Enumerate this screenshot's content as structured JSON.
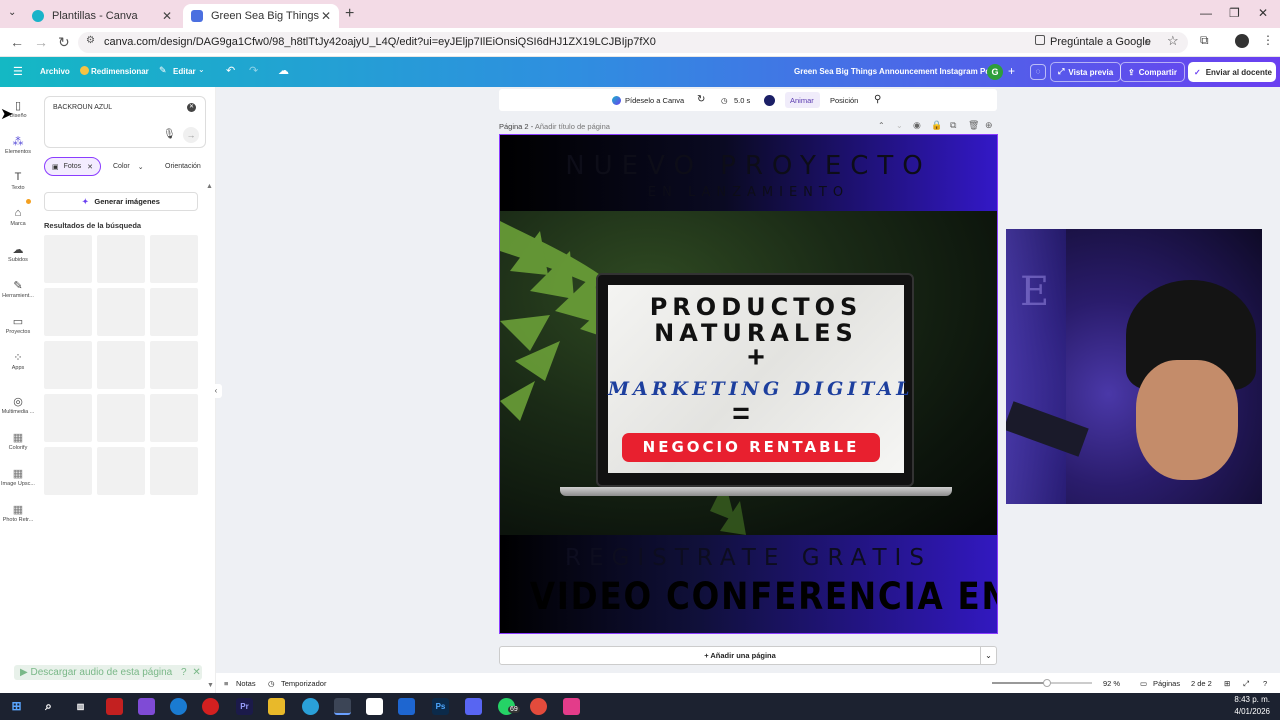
{
  "browser": {
    "tabs": [
      {
        "title": "Plantillas - Canva",
        "active": false
      },
      {
        "title": "Green Sea Big Things Announce",
        "active": true
      }
    ],
    "url": "canva.com/design/DAG9ga1Cfw0/98_h8tlTtJy42oajyU_L4Q/edit?ui=eyJEljp7IlEiOnsiQSI6dHJ1ZX19LCJBIjp7fX0",
    "ask_google": "Pregúntale a Google"
  },
  "canva_bar": {
    "file": "Archivo",
    "resize": "Redimensionar",
    "edit": "Editar",
    "doc_title": "Green Sea Big Things Announcement Instagram Post",
    "avatar": "G",
    "preview": "Vista previa",
    "share": "Compartir",
    "send_teacher": "Enviar al docente"
  },
  "rail": [
    {
      "label": "Diseño",
      "icon": "layout-icon"
    },
    {
      "label": "Elementos",
      "icon": "elements-icon"
    },
    {
      "label": "Texto",
      "icon": "text-icon"
    },
    {
      "label": "Marca",
      "icon": "brand-icon"
    },
    {
      "label": "Subidos",
      "icon": "upload-icon"
    },
    {
      "label": "Herramient...",
      "icon": "tools-icon"
    },
    {
      "label": "Proyectos",
      "icon": "folder-icon"
    },
    {
      "label": "Apps",
      "icon": "apps-icon"
    },
    {
      "label": "Multimedia ...",
      "icon": "media-icon"
    },
    {
      "label": "Colorify",
      "icon": "colorify-icon"
    },
    {
      "label": "Image Upsc...",
      "icon": "upscale-icon"
    },
    {
      "label": "Photo Retr...",
      "icon": "photo-icon"
    }
  ],
  "panel": {
    "search_value": "BACKROUN AZUL",
    "filters": {
      "photos": "Fotos",
      "color": "Color",
      "orientation": "Orientación"
    },
    "generate": "Generar imágenes",
    "results_label": "Resultados de la búsqueda",
    "download_audio": "Descargar audio de esta página"
  },
  "context_bar": {
    "ask_canva": "Pídeselo a Canva",
    "duration": "5.0 s",
    "animate": "Animar",
    "position": "Posición"
  },
  "page": {
    "label": "Página 2",
    "title_placeholder": "Añadir título de página"
  },
  "design": {
    "heading": "NUEVO PROYECTO",
    "subheading": "EN LANZAMIENTO",
    "line1": "PRODUCTOS",
    "line2": "NATURALES",
    "plus": "+",
    "line3": "MARKETING DIGITAL",
    "equals": "=",
    "pill": "NEGOCIO RENTABLE",
    "register": "REGISTRATE GRATIS",
    "conference": "VIDEO CONFERENCIA EN VIVO"
  },
  "add_page": "+ Añadir una página",
  "status": {
    "notes": "Notas",
    "timer": "Temporizador",
    "zoom": "92 %",
    "pages": "Páginas",
    "page_count": "2 de 2"
  },
  "taskbar": {
    "time": "8:43 p. m.",
    "date": "4/01/2026",
    "badge": "69"
  },
  "colors": {
    "accent": "#8b3dff",
    "red_pill": "#e8202f",
    "marketing_blue": "#1d3f9e"
  }
}
